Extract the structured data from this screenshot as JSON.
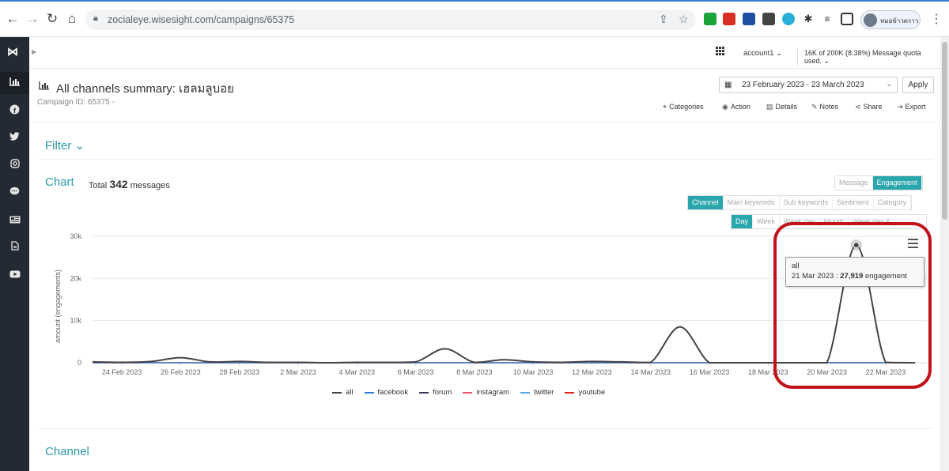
{
  "browser": {
    "url_host": "zocialeye.wisesight.com",
    "url_path": "/campaigns/65375",
    "profile_name": "หมอข้าวตราว"
  },
  "topbar": {
    "account": "account1 ⌄",
    "quota": "16K of 200K (8.38%) Message quota used. ⌄"
  },
  "header": {
    "title": "All channels summary: เฮลมลูบอย",
    "campaign_id": "Campaign ID: 65375 -",
    "date_range": "23 February 2023 - 23 March 2023",
    "apply": "Apply",
    "actions": [
      "Categories",
      "Action",
      "Details",
      "Notes",
      "Share",
      "Export"
    ]
  },
  "filter": {
    "title": "Filter ⌄"
  },
  "chart_section": {
    "title": "Chart",
    "total_prefix": "Total",
    "total_count": "342",
    "total_suffix": "messages",
    "metric_toggle": [
      "Message",
      "Engagement"
    ],
    "group_toggle": [
      "Channel",
      "Main keywords",
      "Sub keywords",
      "Sentiment",
      "Category"
    ],
    "period_toggle": [
      "Day",
      "Week",
      "Week day",
      "Month",
      "Week day &"
    ]
  },
  "chart_data": {
    "type": "line",
    "ylabel": "amount (engagements)",
    "ylim": [
      0,
      30000
    ],
    "yticks": [
      "0",
      "10k",
      "20k",
      "30k"
    ],
    "xticks": [
      "24 Feb 2023",
      "26 Feb 2023",
      "28 Feb 2023",
      "2 Mar 2023",
      "4 Mar 2023",
      "6 Mar 2023",
      "8 Mar 2023",
      "10 Mar 2023",
      "12 Mar 2023",
      "14 Mar 2023",
      "16 Mar 2023",
      "18 Mar 2023",
      "20 Mar 2023",
      "22 Mar 2023"
    ],
    "x": [
      "23 Feb",
      "24 Feb",
      "25 Feb",
      "26 Feb",
      "27 Feb",
      "28 Feb",
      "1 Mar",
      "2 Mar",
      "3 Mar",
      "4 Mar",
      "5 Mar",
      "6 Mar",
      "7 Mar",
      "8 Mar",
      "9 Mar",
      "10 Mar",
      "11 Mar",
      "12 Mar",
      "13 Mar",
      "14 Mar",
      "15 Mar",
      "16 Mar",
      "17 Mar",
      "18 Mar",
      "19 Mar",
      "20 Mar",
      "21 Mar",
      "22 Mar",
      "23 Mar"
    ],
    "series": [
      {
        "name": "all",
        "color": "#434348",
        "values": [
          200,
          100,
          300,
          1200,
          200,
          300,
          100,
          100,
          0,
          100,
          100,
          200,
          3300,
          100,
          700,
          200,
          100,
          300,
          200,
          100,
          8500,
          0,
          0,
          0,
          0,
          0,
          27919,
          100,
          0
        ]
      },
      {
        "name": "facebook",
        "color": "#2f7ed8",
        "values": [
          0,
          0,
          0,
          0,
          0,
          0,
          0,
          0,
          0,
          0,
          0,
          0,
          0,
          0,
          0,
          0,
          0,
          0,
          0,
          0,
          0,
          0,
          0,
          0,
          0,
          0,
          0,
          0,
          0
        ]
      },
      {
        "name": "forum",
        "color": "#383a5e",
        "values": [
          0,
          0,
          0,
          0,
          0,
          0,
          0,
          0,
          0,
          0,
          0,
          0,
          0,
          0,
          0,
          0,
          0,
          0,
          0,
          0,
          0,
          0,
          0,
          0,
          0,
          0,
          0,
          0,
          0
        ]
      },
      {
        "name": "instagram",
        "color": "#e8556b",
        "values": [
          0,
          0,
          0,
          0,
          0,
          0,
          0,
          0,
          0,
          0,
          0,
          0,
          0,
          0,
          0,
          0,
          0,
          0,
          0,
          0,
          0,
          0,
          0,
          0,
          0,
          0,
          0,
          0,
          0
        ]
      },
      {
        "name": "twitter",
        "color": "#5ca4e6",
        "values": [
          0,
          0,
          0,
          0,
          0,
          0,
          0,
          0,
          0,
          0,
          0,
          0,
          0,
          0,
          0,
          0,
          0,
          0,
          0,
          0,
          0,
          0,
          0,
          0,
          0,
          0,
          0,
          0,
          0
        ]
      },
      {
        "name": "youtube",
        "color": "#d9231f",
        "values": [
          0,
          0,
          0,
          0,
          0,
          0,
          0,
          0,
          0,
          0,
          0,
          0,
          0,
          0,
          0,
          0,
          0,
          0,
          0,
          0,
          0,
          0,
          0,
          0,
          0,
          0,
          0,
          0,
          0
        ]
      }
    ],
    "tooltip": {
      "series": "all",
      "date": "21 Mar 2023 :",
      "value": "27,919",
      "unit": "engagement"
    }
  },
  "channel_section": {
    "title": "Channel"
  },
  "sidebar_icons": [
    "chart-icon",
    "facebook-icon",
    "twitter-icon",
    "instagram-icon",
    "chat-icon",
    "news-icon",
    "document-icon",
    "youtube-icon"
  ]
}
